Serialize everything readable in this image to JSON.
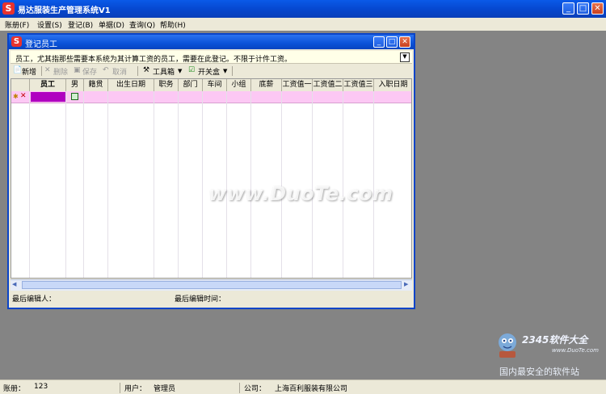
{
  "app": {
    "logo_letter": "S",
    "title": "易达服装生产管理系统V1",
    "controls": {
      "minimize": "_",
      "maximize": "□",
      "close": "✕"
    }
  },
  "menu": [
    {
      "label": "账册(F)"
    },
    {
      "label": "设置(S)"
    },
    {
      "label": "登记(B)"
    },
    {
      "label": "单据(D)"
    },
    {
      "label": "查询(Q)"
    },
    {
      "label": "帮助(H)"
    }
  ],
  "child_window": {
    "logo_letter": "S",
    "title": "登记员工",
    "info_text": "员工，尤其指那些需要本系统为其计算工资的员工，需要在此登记。不限于计件工资。",
    "toolbar": {
      "add": "新增",
      "delete": "删除",
      "save": "保存",
      "cancel": "取消",
      "toolbox": "工具箱",
      "switchbox": "开关盒"
    },
    "columns": [
      "员工",
      "男",
      "籍贯",
      "出生日期",
      "职务",
      "部门",
      "车间",
      "小组",
      "底薪",
      "工资值一",
      "工资值二",
      "工资值三",
      "入职日期"
    ],
    "status": {
      "last_editor_label": "最后编辑人：",
      "last_edit_time_label": "最后编辑时间："
    }
  },
  "statusbar": {
    "ledger_label": "账册：",
    "ledger_value": "123",
    "user_label": "用户：",
    "user_value": "管理员",
    "company_label": "公司：",
    "company_value": "上海百利服装有限公司"
  },
  "watermarks": {
    "duote": "www.DuoTe.com",
    "brand": "2345软件大全",
    "brand_url": "www.DuoTe.com",
    "slogan": "国内最安全的软件站"
  },
  "colors": {
    "title_blue": "#0a52d8",
    "row_pink": "#fcc8f4",
    "cell_purple": "#b000c0",
    "desktop_gray": "#848484"
  }
}
